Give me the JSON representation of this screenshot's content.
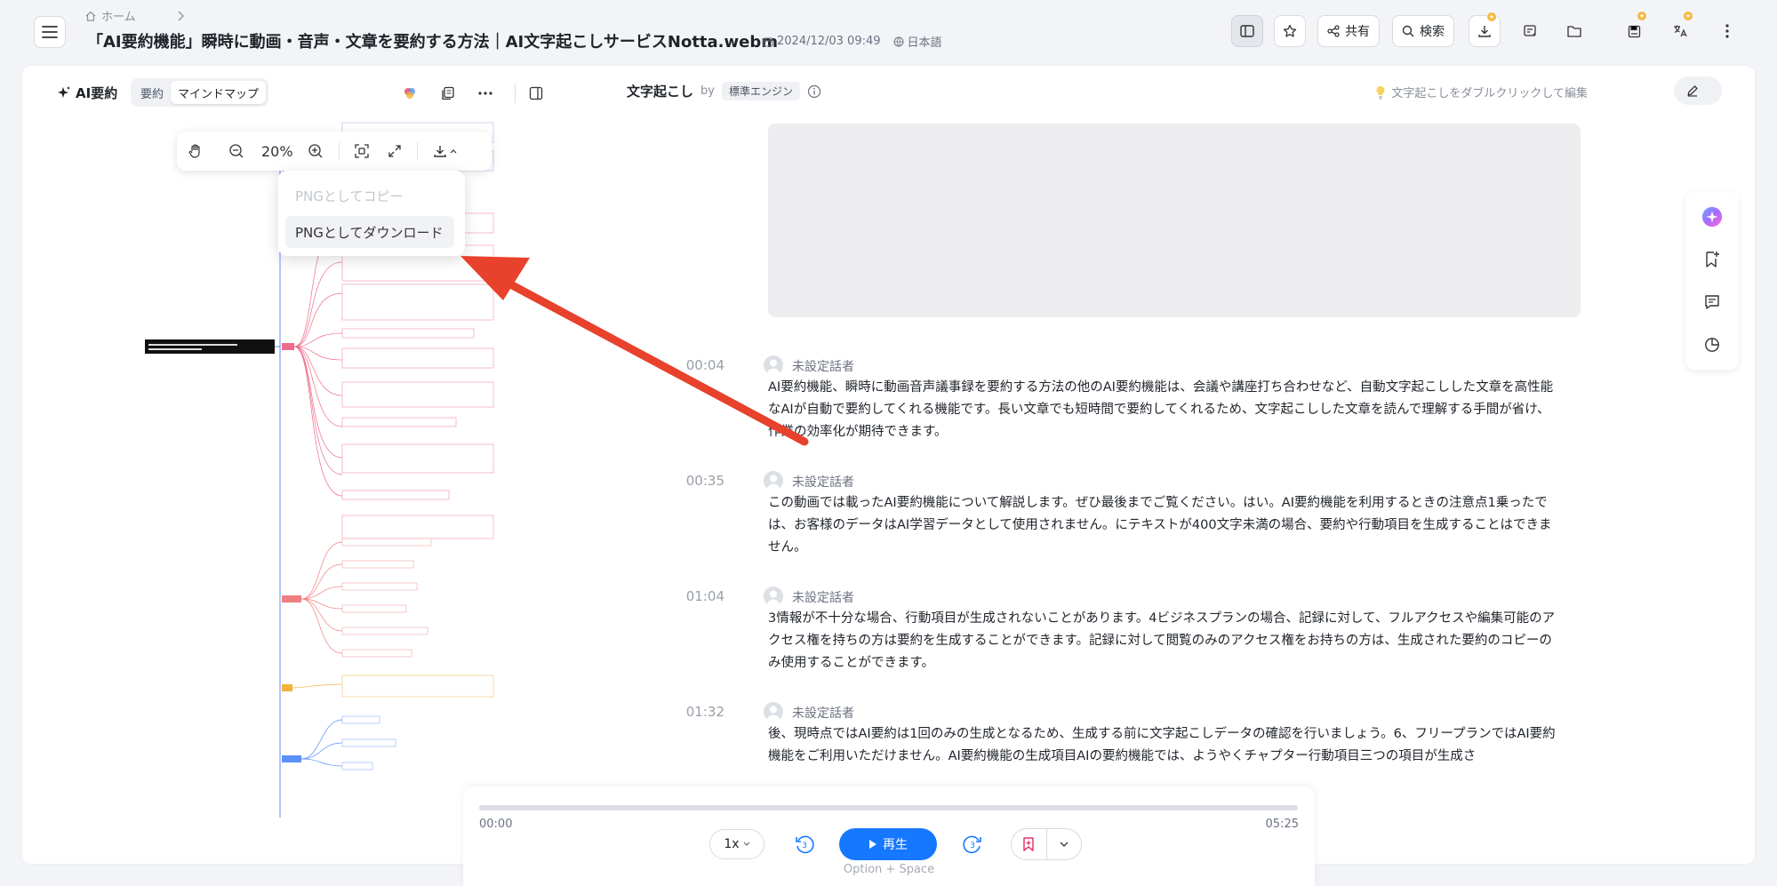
{
  "header": {
    "breadcrumb_home": "ホーム",
    "title": "「AI要約機能」瞬時に動画・音声・文章を要約する方法｜AI文字起こしサービスNotta.webm",
    "datetime": "2024/12/03 09:49",
    "language": "日本語",
    "share_label": "共有",
    "search_label": "検索"
  },
  "left": {
    "ai_summary_label": "AI要約",
    "tabs": [
      "要約",
      "マインドマップ"
    ],
    "zoom": "20%",
    "dropdown": {
      "copy_png": "PNGとしてコピー",
      "download_png": "PNGとしてダウンロード"
    }
  },
  "right": {
    "transcript_title": "文字起こし",
    "by": "by",
    "engine": "標準エンジン",
    "edit_hint": "文字起こしをダブルクリックして編集",
    "segments": [
      {
        "time": "00:04",
        "speaker": "未設定話者",
        "text": "AI要約機能、瞬時に動画音声議事録を要約する方法の他のAI要約機能は、会議や講座打ち合わせなど、自動文字起こしした文章を高性能なAIが自動で要約してくれる機能です。長い文章でも短時間で要約してくれるため、文字起こしした文章を読んで理解する手間が省け、作業の効率化が期待できます。"
      },
      {
        "time": "00:35",
        "speaker": "未設定話者",
        "text": "この動画では載ったAI要約機能について解説します。ぜひ最後までご覧ください。はい。AI要約機能を利用するときの注意点1乗ったでは、お客様のデータはAI学習データとして使用されません。にテキストが400文字未満の場合、要約や行動項目を生成することはできません。"
      },
      {
        "time": "01:04",
        "speaker": "未設定話者",
        "text": "3情報が不十分な場合、行動項目が生成されないことがあります。4ビジネスプランの場合、記録に対して、フルアクセスや編集可能のアクセス権を持ちの方は要約を生成することができます。記録に対して閲覧のみのアクセス権をお持ちの方は、生成された要約のコピーのみ使用することができます。"
      },
      {
        "time": "01:32",
        "speaker": "未設定話者",
        "text": "後、現時点ではAI要約は1回のみの生成となるため、生成する前に文字起こしデータの確認を行いましょう。6、フリープランではAI要約機能をご利用いただけません。AI要約機能の生成項目AIの要約機能では、ようやくチャプター行動項目三つの項目が生成さ"
      }
    ]
  },
  "player": {
    "current_time": "00:00",
    "duration": "05:25",
    "progress": 0.0,
    "speed": "1x",
    "skip_seconds": "3",
    "play_label": "再生",
    "shortcut_hint": "Option + Space"
  },
  "colors": {
    "accent": "#1677ff",
    "arrow": "#e8412c",
    "mindmap_pink": "#ef6c8a",
    "mindmap_orange": "#f4b13b",
    "mindmap_blue": "#5b8ff9"
  }
}
